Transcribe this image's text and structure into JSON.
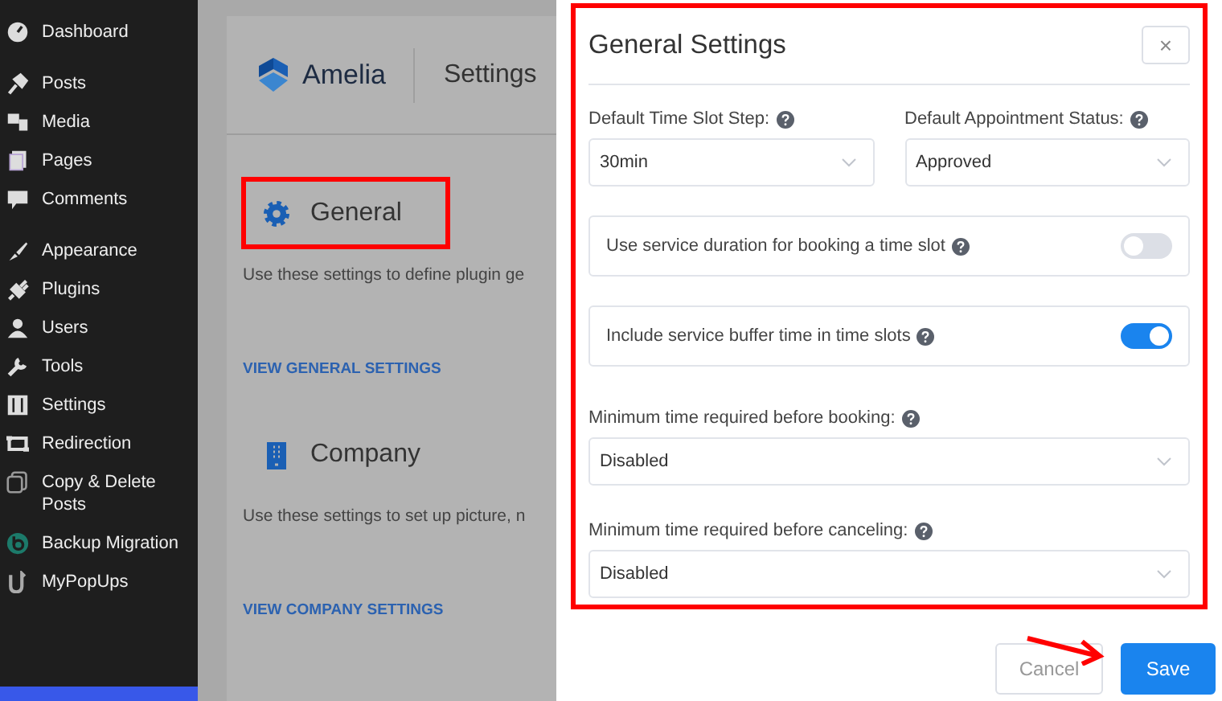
{
  "sidebar": {
    "groups": [
      {
        "items": [
          {
            "label": "Dashboard"
          }
        ]
      },
      {
        "items": [
          {
            "label": "Posts"
          },
          {
            "label": "Media"
          },
          {
            "label": "Pages"
          },
          {
            "label": "Comments"
          }
        ]
      },
      {
        "items": [
          {
            "label": "Appearance"
          },
          {
            "label": "Plugins"
          },
          {
            "label": "Users"
          },
          {
            "label": "Tools"
          },
          {
            "label": "Settings"
          },
          {
            "label": "Redirection"
          },
          {
            "label": "Copy & Delete Posts"
          },
          {
            "label": "Backup Migration"
          },
          {
            "label": "MyPopUps"
          }
        ]
      }
    ]
  },
  "page": {
    "brand": "Amelia",
    "title": "Settings",
    "sections": [
      {
        "kind": "gear",
        "heading": "General",
        "highlighted": true,
        "description": "Use these settings to define plugin ge",
        "link": "VIEW GENERAL SETTINGS"
      },
      {
        "kind": "building",
        "heading": "Company",
        "highlighted": false,
        "description": "Use these settings to set up picture, n",
        "link": "VIEW COMPANY SETTINGS"
      }
    ]
  },
  "modal": {
    "title": "General Settings",
    "close": "×",
    "rows": [
      {
        "kind": "selects",
        "items": [
          {
            "label": "Default Time Slot Step:",
            "value": "30min"
          },
          {
            "label": "Default Appointment Status:",
            "value": "Approved"
          }
        ]
      },
      {
        "kind": "toggle",
        "label": "Use service duration for booking a time slot",
        "on": false
      },
      {
        "kind": "toggle",
        "label": "Include service buffer time in time slots",
        "on": true
      },
      {
        "kind": "select",
        "label": "Minimum time required before booking:",
        "value": "Disabled"
      },
      {
        "kind": "select",
        "label": "Minimum time required before canceling:",
        "value": "Disabled"
      }
    ],
    "buttons": [
      {
        "label": "Cancel",
        "kind": "secondary"
      },
      {
        "label": "Save",
        "kind": "primary"
      }
    ]
  }
}
